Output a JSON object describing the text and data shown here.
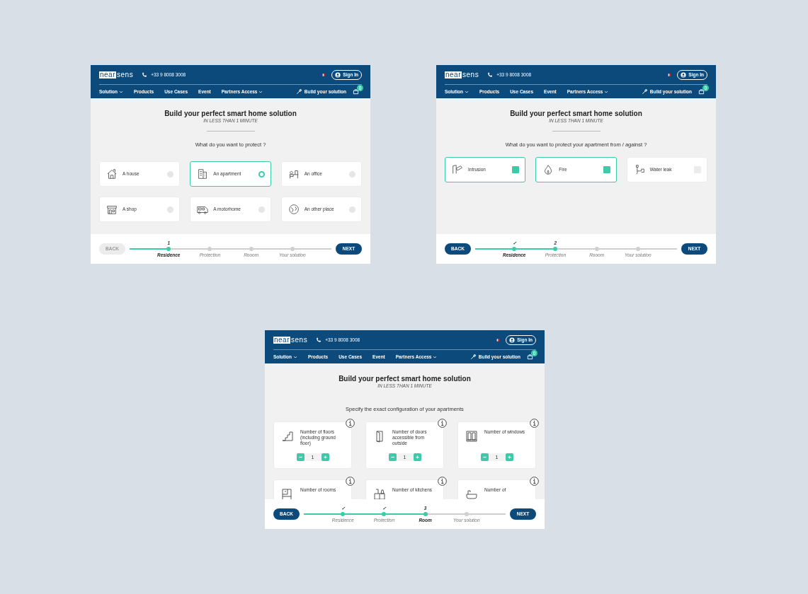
{
  "screens": [
    {
      "kind": "options",
      "header": {
        "logo": {
          "boxed": "near",
          "plain": "sens"
        },
        "phone": "+33 9 8008 3008",
        "sign_in": "Sign In",
        "nav": [
          {
            "label": "Solution",
            "dropdown": true
          },
          {
            "label": "Products",
            "dropdown": false
          },
          {
            "label": "Use Cases",
            "dropdown": false
          },
          {
            "label": "Event",
            "dropdown": false
          },
          {
            "label": "Partners Access",
            "dropdown": true
          }
        ],
        "build": "Build your solution",
        "cart_count": "0"
      },
      "title": "Build your perfect smart home solution",
      "subtitle": "IN LESS THAN 1 MINUTE",
      "question": "What do you want to protect ?",
      "options": [
        {
          "label": "A house",
          "selected": false
        },
        {
          "label": "An apartment",
          "selected": true
        },
        {
          "label": "An office",
          "selected": false
        },
        {
          "label": "A shop",
          "selected": false
        },
        {
          "label": "A motorhome",
          "selected": false
        },
        {
          "label": "An other place",
          "selected": false
        }
      ],
      "steps": [
        {
          "label": "Residence",
          "marker": "1",
          "reached": true,
          "selected": true
        },
        {
          "label": "Protection",
          "reached": false,
          "selected": false
        },
        {
          "label": "Rooom",
          "reached": false,
          "selected": false
        },
        {
          "label": "Your solution",
          "reached": false,
          "selected": false
        }
      ],
      "back": {
        "label": "BACK",
        "disabled": true
      },
      "next": "NEXT"
    },
    {
      "kind": "checks",
      "header": {
        "logo": {
          "boxed": "near",
          "plain": "sens"
        },
        "phone": "+33 9 8008 3008",
        "sign_in": "Sign In",
        "nav": [
          {
            "label": "Solution",
            "dropdown": true
          },
          {
            "label": "Products",
            "dropdown": false
          },
          {
            "label": "Use Cases",
            "dropdown": false
          },
          {
            "label": "Event",
            "dropdown": false
          },
          {
            "label": "Partners Access",
            "dropdown": true
          }
        ],
        "build": "Build your solution",
        "cart_count": "0"
      },
      "title": "Build your perfect smart home solution",
      "subtitle": "IN LESS THAN 1 MINUTE",
      "question": "What do you want to protect your apartment from / against ?",
      "options": [
        {
          "label": "Intrusion",
          "checked": true
        },
        {
          "label": "Fire",
          "checked": true
        },
        {
          "label": "Water leak",
          "checked": false
        }
      ],
      "steps": [
        {
          "label": "Residence",
          "marker": "✓",
          "reached": true,
          "selected": true
        },
        {
          "label": "Protection",
          "marker": "2",
          "reached": true,
          "selected": false
        },
        {
          "label": "Rooom",
          "reached": false,
          "selected": false
        },
        {
          "label": "Your solution",
          "reached": false,
          "selected": false
        }
      ],
      "back": {
        "label": "BACK",
        "disabled": false
      },
      "next": "NEXT"
    },
    {
      "kind": "counters",
      "header": {
        "logo": {
          "boxed": "near",
          "plain": "sens"
        },
        "phone": "+33 9 8008 3008",
        "sign_in": "Sign In",
        "nav": [
          {
            "label": "Solution",
            "dropdown": true
          },
          {
            "label": "Products",
            "dropdown": false
          },
          {
            "label": "Use Cases",
            "dropdown": false
          },
          {
            "label": "Event",
            "dropdown": false
          },
          {
            "label": "Partners Access",
            "dropdown": true
          }
        ],
        "build": "Build your solution",
        "cart_count": "0"
      },
      "title": "Build your perfect smart home solution",
      "subtitle": "IN LESS THAN 1 MINUTE",
      "question": "Specify the exact configuration of your apartments",
      "options": [
        {
          "label": "Number of floors (including ground floor)",
          "value": "1"
        },
        {
          "label": "Number of doors accessible from outside",
          "value": "1"
        },
        {
          "label": "Number of windows",
          "value": "1"
        },
        {
          "label": "Number of rooms"
        },
        {
          "label": "Number of kitchens"
        },
        {
          "label": "Number of"
        }
      ],
      "steps": [
        {
          "label": "Residence",
          "marker": "✓",
          "reached": true,
          "selected": false
        },
        {
          "label": "Protection",
          "marker": "✓",
          "reached": true,
          "selected": false
        },
        {
          "label": "Room",
          "marker": "3",
          "reached": true,
          "selected": true
        },
        {
          "label": "Your solution",
          "reached": false,
          "selected": false
        }
      ],
      "back": {
        "label": "BACK",
        "disabled": false
      },
      "next": "NEXT"
    }
  ]
}
